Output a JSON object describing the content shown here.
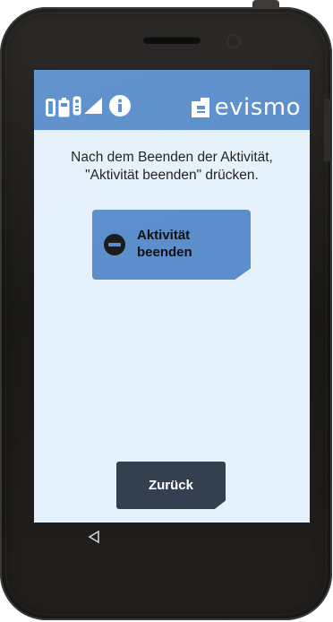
{
  "header": {
    "brand": "evismo",
    "icons": [
      "phone-icon",
      "battery-icon",
      "remote-icon",
      "signal-icon",
      "info-icon"
    ]
  },
  "main": {
    "instruction_line1": "Nach dem Beenden der Aktivität,",
    "instruction_line2": "\"Aktivität beenden\" drücken.",
    "end_activity_line1": "Aktivität",
    "end_activity_line2": "beenden",
    "back_label": "Zurück"
  },
  "nav": {
    "back_icon": "triangle-back-icon"
  },
  "colors": {
    "header_bg": "#5b8ecb",
    "screen_bg": "#e5f1fb",
    "back_button_bg": "#34404f"
  }
}
